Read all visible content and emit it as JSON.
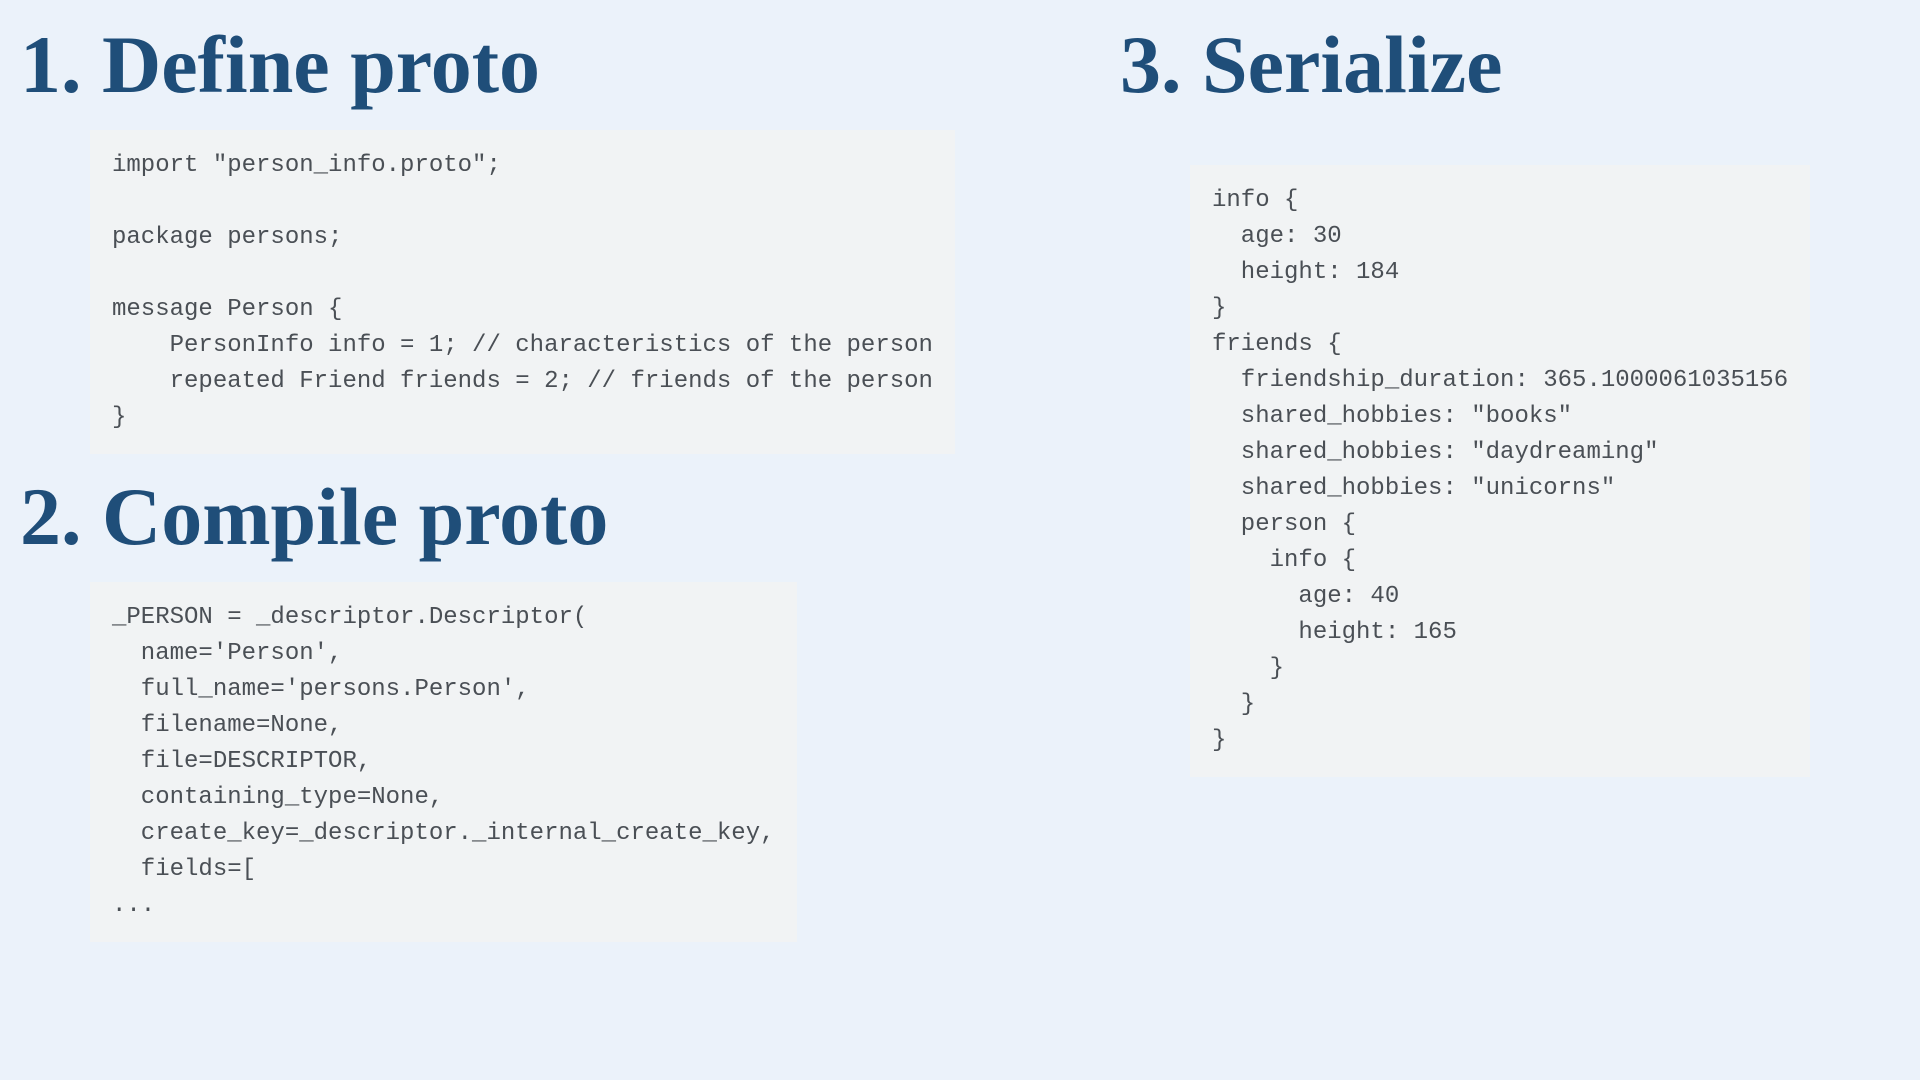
{
  "left": {
    "heading1": "1. Define proto",
    "code1": "import \"person_info.proto\";\n\npackage persons;\n\nmessage Person {\n    PersonInfo info = 1; // characteristics of the person\n    repeated Friend friends = 2; // friends of the person\n}",
    "heading2": "2. Compile proto",
    "code2": "_PERSON = _descriptor.Descriptor(\n  name='Person',\n  full_name='persons.Person',\n  filename=None,\n  file=DESCRIPTOR,\n  containing_type=None,\n  create_key=_descriptor._internal_create_key,\n  fields=[\n..."
  },
  "right": {
    "heading3": "3. Serialize",
    "code3": "info {\n  age: 30\n  height: 184\n}\nfriends {\n  friendship_duration: 365.1000061035156\n  shared_hobbies: \"books\"\n  shared_hobbies: \"daydreaming\"\n  shared_hobbies: \"unicorns\"\n  person {\n    info {\n      age: 40\n      height: 165\n    }\n  }\n}"
  }
}
